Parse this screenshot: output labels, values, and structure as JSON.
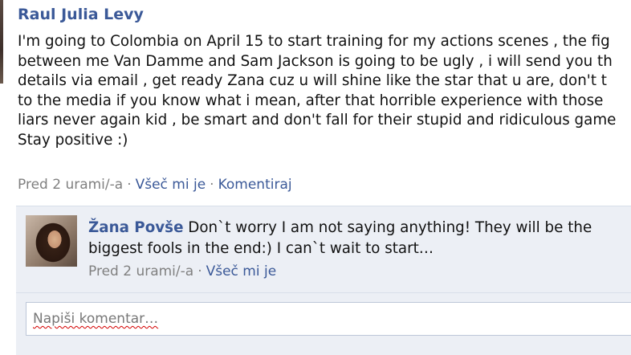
{
  "post": {
    "author": "Raul Julia Levy",
    "lines": [
      "I'm going to Colombia on April 15 to start training for my actions scenes , the fig",
      "between me Van Damme and Sam Jackson is going to be ugly , i will send you th",
      "details via email , get ready Zana cuz u will shine like the star that u are, don't t",
      "to the media if you know what i mean, after that horrible experience with those",
      "liars never again kid , be smart and don't fall for their stupid and ridiculous game",
      "Stay positive :)"
    ],
    "timestamp": "Pred 2 urami/-a",
    "separator": "·",
    "like_label": "Všeč mi je",
    "comment_label": "Komentiraj"
  },
  "comment": {
    "author": "Žana Povše",
    "text_line1": " Don`t worry I am not saying anything! They will be the",
    "text_line2": "biggest fools in the end:) I can`t wait to start…",
    "timestamp": "Pred 2 urami/-a",
    "separator": "·",
    "like_label": "Všeč mi je"
  },
  "comment_box": {
    "placeholder": "Napiši komentar…"
  },
  "colors": {
    "link": "#3b5998",
    "meta": "#808080",
    "comment_background": "#eceff5"
  }
}
